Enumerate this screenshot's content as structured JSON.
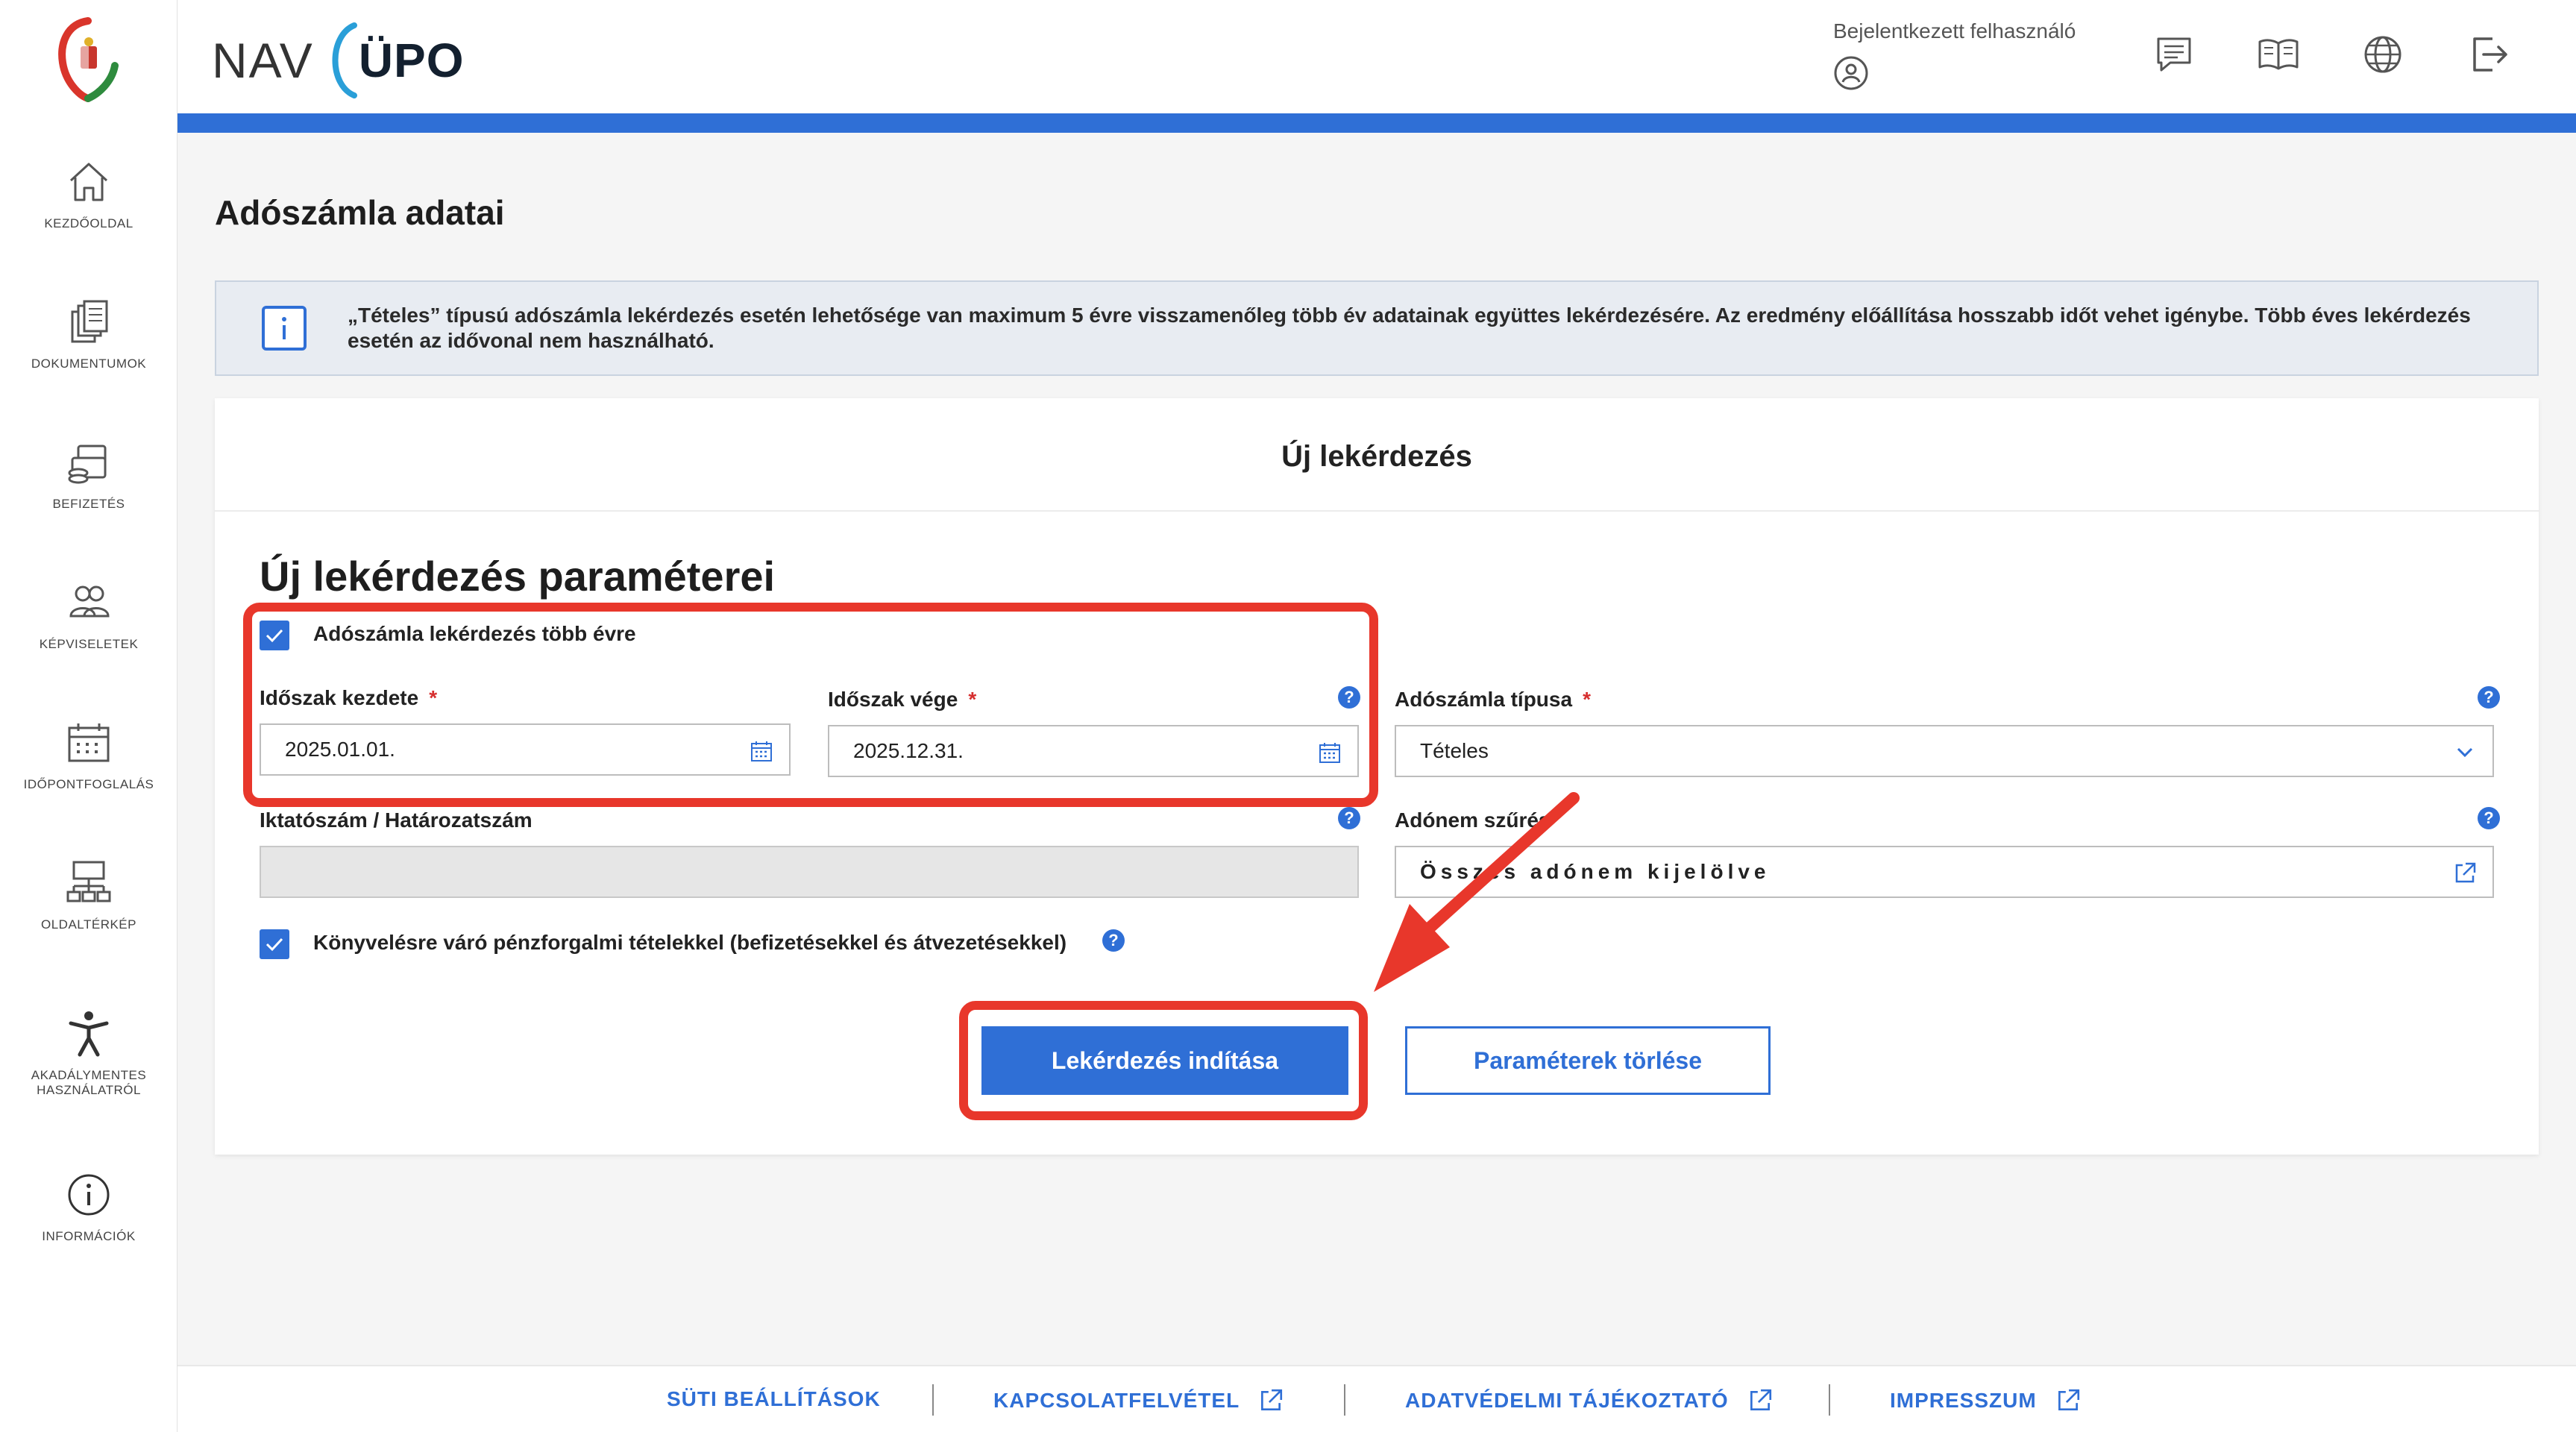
{
  "sidebar": {
    "items": [
      {
        "label": "KEZDŐOLDAL",
        "icon": "home-icon"
      },
      {
        "label": "DOKUMENTUMOK",
        "icon": "documents-icon"
      },
      {
        "label": "BEFIZETÉS",
        "icon": "payment-icon"
      },
      {
        "label": "KÉPVISELETEK",
        "icon": "representation-icon"
      },
      {
        "label": "IDŐPONTFOGLALÁS",
        "icon": "calendar-icon"
      },
      {
        "label": "OLDALTÉRKÉP",
        "icon": "sitemap-icon"
      },
      {
        "label": "AKADÁLYMENTES HASZNÁLATRÓL",
        "icon": "accessibility-icon"
      },
      {
        "label": "INFORMÁCIÓK",
        "icon": "info-icon"
      }
    ]
  },
  "header": {
    "brand_left": "NAV",
    "brand_right": "ÜPO",
    "user_label": "Bejelentkezett felhasználó",
    "accent_color": "#2f6fd6"
  },
  "page": {
    "title": "Adószámla adatai",
    "info_text": "„Tételes” típusú adószámla lekérdezés esetén lehetősége van maximum 5 évre visszamenőleg több év adatainak együttes lekérdezésére. Az eredmény előállítása hosszabb időt vehet igénybe. Több éves lekérdezés esetén az idővonal nem használható."
  },
  "form": {
    "card_title": "Új lekérdezés",
    "section_title": "Új lekérdezés paraméterei",
    "multi_year_label": "Adószámla lekérdezés több évre",
    "multi_year_checked": true,
    "period_start_label": "Időszak kezdete",
    "period_start_value": "2025.01.01.",
    "period_end_label": "Időszak vége",
    "period_end_value": "2025.12.31.",
    "account_type_label": "Adószámla típusa",
    "account_type_value": "Tételes",
    "reference_label": "Iktatószám / Határozatszám",
    "reference_value": "",
    "tax_filter_label": "Adónem szűrés",
    "tax_filter_value": "Összes adónem kijelölve",
    "pending_label": "Könyvelésre váró pénzforgalmi tételekkel (befizetésekkel és átvezetésekkel)",
    "pending_checked": true,
    "required_mark": "*",
    "help_mark": "?",
    "submit_label": "Lekérdezés indítása",
    "clear_label": "Paraméterek törlése"
  },
  "footer": {
    "links": [
      {
        "label": "SÜTI BEÁLLÍTÁSOK"
      },
      {
        "label": "KAPCSOLATFELVÉTEL"
      },
      {
        "label": "ADATVÉDELMI TÁJÉKOZTATÓ"
      },
      {
        "label": "IMPRESSZUM"
      }
    ]
  },
  "annotation_color": "#e8372b"
}
